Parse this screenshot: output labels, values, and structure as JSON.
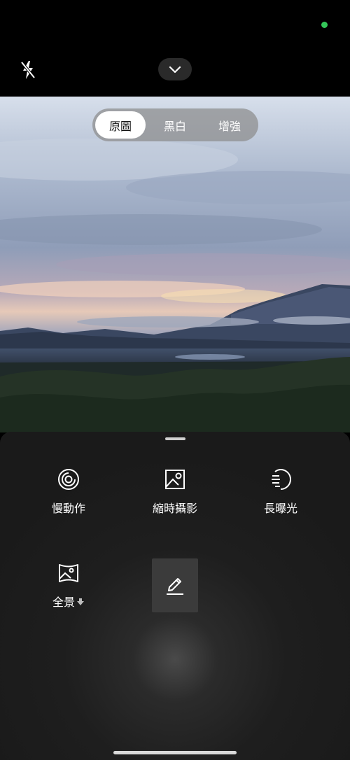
{
  "status": {
    "indicator_color": "#34c759"
  },
  "topbar": {
    "flash_icon": "flash-off-icon",
    "expand_icon": "chevron-down-icon"
  },
  "filters": {
    "items": [
      {
        "label": "原圖",
        "active": true
      },
      {
        "label": "黑白",
        "active": false
      },
      {
        "label": "增強",
        "active": false
      }
    ]
  },
  "modes": {
    "slow_motion": {
      "label": "慢動作",
      "icon": "slow-motion-icon"
    },
    "timelapse": {
      "label": "縮時攝影",
      "icon": "timelapse-icon"
    },
    "long_exposure": {
      "label": "長曝光",
      "icon": "long-exposure-icon"
    },
    "panorama": {
      "label": "全景",
      "icon": "panorama-icon",
      "badge_icon": "download-arrow-icon"
    },
    "edit": {
      "icon": "pencil-edit-icon"
    }
  },
  "colors": {
    "active_pill": "#ffffff",
    "sheet_bg": "#1e1e1e"
  }
}
